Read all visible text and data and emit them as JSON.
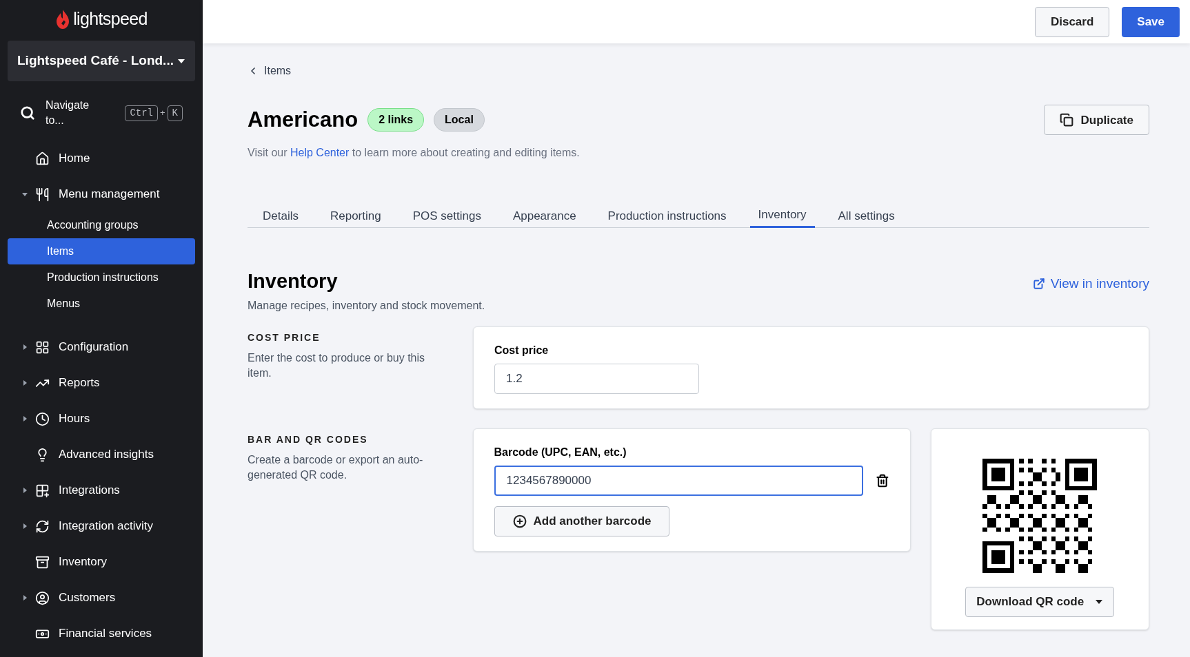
{
  "header": {
    "discard": "Discard",
    "save": "Save"
  },
  "sidebar": {
    "logo": "lightspeed",
    "store": "Lightspeed Café - Lond...",
    "navigate": {
      "label": "Navigate to...",
      "keys": [
        "Ctrl",
        "K"
      ],
      "joiner": "+"
    },
    "items": [
      {
        "label": "Home",
        "expandable": false,
        "selected": false
      },
      {
        "label": "Menu management",
        "expandable": true,
        "expanded": true,
        "selected": false,
        "children": [
          {
            "label": "Accounting groups",
            "selected": false
          },
          {
            "label": "Items",
            "selected": true
          },
          {
            "label": "Production instructions",
            "selected": false
          },
          {
            "label": "Menus",
            "selected": false
          }
        ]
      },
      {
        "label": "Configuration",
        "expandable": true,
        "expanded": false,
        "selected": false
      },
      {
        "label": "Reports",
        "expandable": true,
        "expanded": false,
        "selected": false
      },
      {
        "label": "Hours",
        "expandable": true,
        "expanded": false,
        "selected": false
      },
      {
        "label": "Advanced insights",
        "expandable": false,
        "selected": false
      },
      {
        "label": "Integrations",
        "expandable": true,
        "expanded": false,
        "selected": false
      },
      {
        "label": "Integration activity",
        "expandable": true,
        "expanded": false,
        "selected": false
      },
      {
        "label": "Inventory",
        "expandable": false,
        "selected": false
      },
      {
        "label": "Customers",
        "expandable": true,
        "expanded": false,
        "selected": false
      },
      {
        "label": "Financial services",
        "expandable": false,
        "selected": false
      }
    ]
  },
  "breadcrumb": "Items",
  "title": "Americano",
  "badges": [
    {
      "label": "2 links",
      "kind": "linked"
    },
    {
      "label": "Local",
      "kind": "neutral"
    }
  ],
  "duplicate": "Duplicate",
  "description": {
    "before": "Visit our",
    "link": "Help Center",
    "after": "to learn more about creating and editing items."
  },
  "tabs": [
    {
      "label": "Details",
      "selected": false
    },
    {
      "label": "Reporting",
      "selected": false
    },
    {
      "label": "POS settings",
      "selected": false
    },
    {
      "label": "Appearance",
      "selected": false
    },
    {
      "label": "Production instructions",
      "selected": false
    },
    {
      "label": "Inventory",
      "selected": true
    },
    {
      "label": "All settings",
      "selected": false
    }
  ],
  "section": {
    "title": "Inventory",
    "subtitle": "Manage recipes, inventory and stock movement.",
    "link": "View in inventory"
  },
  "cost": {
    "heading": "COST PRICE",
    "text": "Enter the cost to produce or buy this item.",
    "field_label": "Cost price",
    "value": "1.2",
    "focused": false
  },
  "codes": {
    "heading": "BAR AND QR CODES",
    "text": "Create a barcode or export an auto-generated QR code.",
    "field_label": "Barcode (UPC, EAN, etc.)",
    "value": "1234567890000",
    "focused": true,
    "add": "Add another barcode",
    "download": "Download QR code"
  }
}
